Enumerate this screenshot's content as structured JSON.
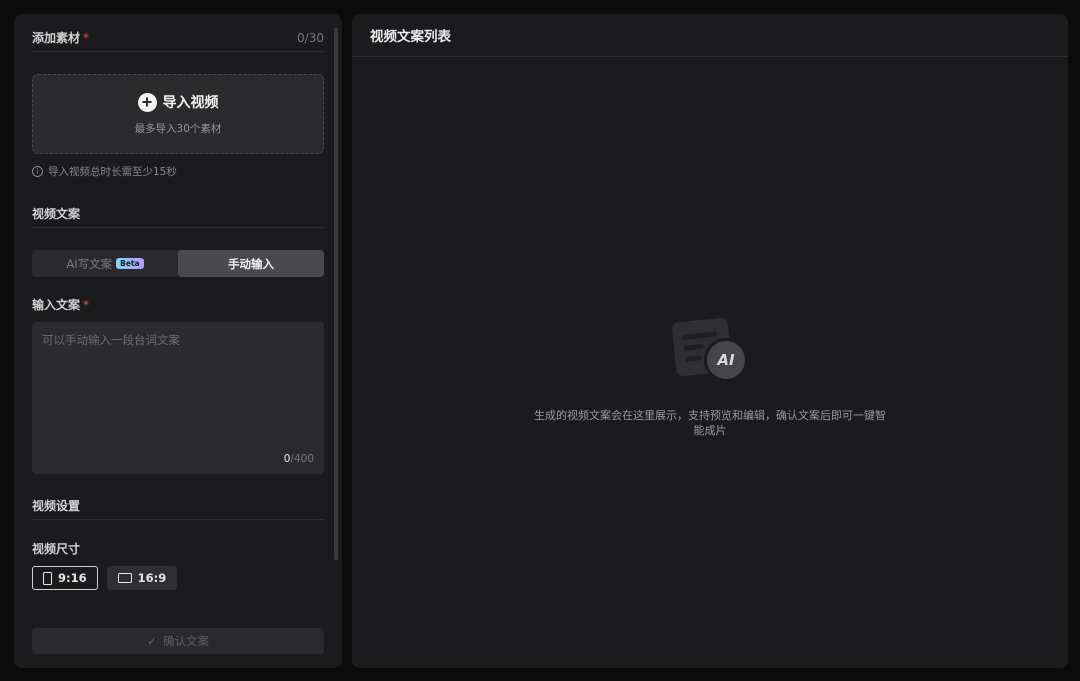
{
  "left": {
    "materials": {
      "title": "添加素材",
      "required_mark": "*",
      "count": "0/30",
      "import_label": "导入视频",
      "import_sub": "最多导入30个素材",
      "hint": "导入视频总时长需至少15秒"
    },
    "copy_section": {
      "title": "视频文案",
      "tabs": [
        {
          "label": "AI写文案",
          "badge": "Beta",
          "active": false
        },
        {
          "label": "手动输入",
          "active": true
        }
      ]
    },
    "input_copy": {
      "label": "输入文案",
      "required_mark": "*",
      "placeholder": "可以手动输入一段台词文案",
      "value": "",
      "count_current": "0",
      "count_max": "/400"
    },
    "settings": {
      "title": "视频设置",
      "size_label": "视频尺寸",
      "sizes": [
        {
          "label": "9:16",
          "active": true
        },
        {
          "label": "16:9",
          "active": false
        }
      ]
    },
    "confirm_label": "确认文案"
  },
  "right": {
    "title": "视频文案列表",
    "ai_badge": "AI",
    "empty_text": "生成的视频文案会在这里展示，支持预览和编辑，确认文案后即可一键智能成片"
  }
}
